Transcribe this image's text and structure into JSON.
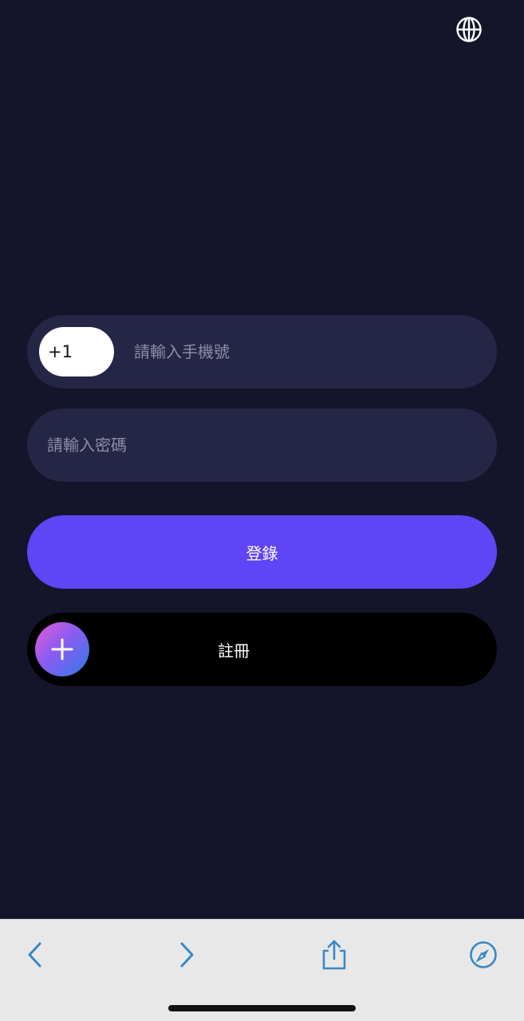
{
  "header": {
    "language_icon": "globe-icon"
  },
  "login_form": {
    "country_code": "+1",
    "phone_placeholder": "請輸入手機號",
    "phone_value": "",
    "password_placeholder": "請輸入密碼",
    "password_value": "",
    "login_label": "登錄",
    "register_label": "註冊",
    "register_icon": "plus-icon"
  },
  "browser_toolbar": {
    "back_icon": "chevron-left-icon",
    "forward_icon": "chevron-right-icon",
    "share_icon": "share-icon",
    "compass_icon": "compass-icon"
  },
  "colors": {
    "background": "#14152a",
    "field": "#252546",
    "accent": "#5f45f5",
    "toolbar": "#e8e8e8",
    "toolbar_icon": "#3a87c7"
  }
}
